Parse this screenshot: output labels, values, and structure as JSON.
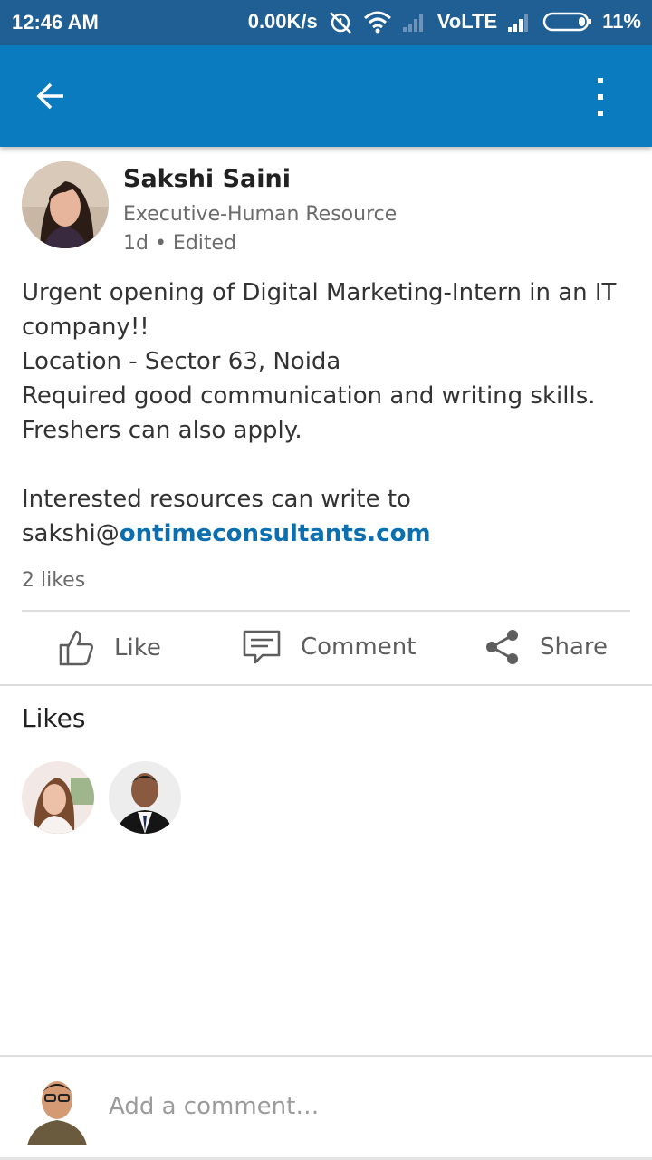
{
  "status_bar": {
    "time": "12:46 AM",
    "net_speed": "0.00K/s",
    "network_label": "VoLTE",
    "battery": "11%",
    "icons": [
      "alarm-off-icon",
      "wifi-icon",
      "signal-weak-icon",
      "signal-icon",
      "battery-icon"
    ]
  },
  "app_bar": {
    "icons": [
      "back-arrow-icon",
      "more-vert-icon"
    ],
    "color": "#0a7bbf"
  },
  "post": {
    "author_name": "Sakshi Saini",
    "author_headline": "Executive-Human Resource",
    "meta": "1d • Edited",
    "body_lines": [
      "Urgent opening of Digital Marketing-Intern in an IT",
      "company!!",
      "Location - Sector 63, Noida",
      "Required good communication and writing skills.",
      "Freshers can also apply."
    ],
    "contact_line": "Interested resources can write to",
    "email_user": "sakshi@",
    "email_domain": "ontimeconsultants.com",
    "likes_count": "2 likes"
  },
  "actions": {
    "like": "Like",
    "comment": "Comment",
    "share": "Share",
    "icons": [
      "thumbs-up-icon",
      "comment-icon",
      "share-icon"
    ]
  },
  "likes_section": {
    "heading": "Likes",
    "liker_count": 2
  },
  "comment_bar": {
    "placeholder": "Add a comment…"
  },
  "colors": {
    "status_bar": "#1f5f94",
    "link": "#0b6fb0"
  }
}
